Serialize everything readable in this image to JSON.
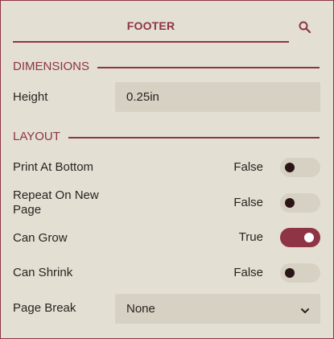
{
  "header": {
    "title": "FOOTER"
  },
  "sections": {
    "dimensions": {
      "label": "DIMENSIONS"
    },
    "layout": {
      "label": "LAYOUT"
    }
  },
  "dimensions": {
    "height_label": "Height",
    "height_value": "0.25in"
  },
  "layout": {
    "print_at_bottom": {
      "label": "Print At Bottom",
      "value_text": "False",
      "on": false
    },
    "repeat_on_new_page": {
      "label_line1": "Repeat On New",
      "label_line2": "Page",
      "value_text": "False",
      "on": false
    },
    "can_grow": {
      "label": "Can Grow",
      "value_text": "True",
      "on": true
    },
    "can_shrink": {
      "label": "Can Shrink",
      "value_text": "False",
      "on": false
    },
    "page_break": {
      "label": "Page Break",
      "value": "None"
    }
  },
  "icons": {
    "search": "search-icon",
    "dropdown": "chevron-down-icon"
  },
  "colors": {
    "accent": "#8e3444",
    "background": "#e3dfd2",
    "field_background": "#d6d1c3",
    "text": "#2a2322"
  }
}
